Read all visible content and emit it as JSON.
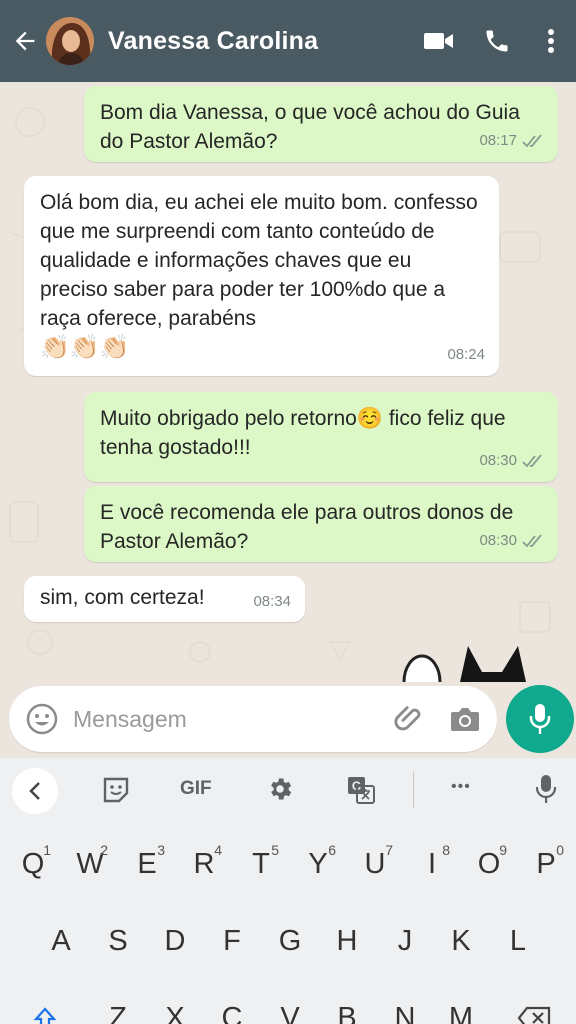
{
  "header": {
    "contact_name": "Vanessa Carolina"
  },
  "messages": [
    {
      "dir": "out",
      "text": "Bom dia Vanessa, o que você achou do Guia do Pastor Alemão?",
      "time": "08:17"
    },
    {
      "dir": "in",
      "text": "Olá bom dia, eu achei ele muito bom. confesso que me surpreendi com tanto conteúdo de qualidade e informações chaves que eu preciso saber para poder ter 100%do que a raça oferece, parabéns",
      "emoji": "👏🏻👏🏻👏🏻",
      "time": "08:24"
    },
    {
      "dir": "out",
      "text_before": "Muito obrigado pelo retorno",
      "emoji": "☺️",
      "text_after": " fico feliz que tenha gostado!!!",
      "time": "08:30"
    },
    {
      "dir": "out",
      "text": "E você recomenda ele para outros donos de Pastor Alemão?",
      "time": "08:30"
    },
    {
      "dir": "in",
      "text": "sim, com certeza!",
      "time": "08:34"
    }
  ],
  "input": {
    "placeholder": "Mensagem"
  },
  "keyboard_toolbar": {
    "gif_label": "GIF",
    "more_label": "•••"
  },
  "keyboard": {
    "row1": [
      {
        "k": "Q",
        "n": "1"
      },
      {
        "k": "W",
        "n": "2"
      },
      {
        "k": "E",
        "n": "3"
      },
      {
        "k": "R",
        "n": "4"
      },
      {
        "k": "T",
        "n": "5"
      },
      {
        "k": "Y",
        "n": "6"
      },
      {
        "k": "U",
        "n": "7"
      },
      {
        "k": "I",
        "n": "8"
      },
      {
        "k": "O",
        "n": "9"
      },
      {
        "k": "P",
        "n": "0"
      }
    ],
    "row2": [
      "A",
      "S",
      "D",
      "F",
      "G",
      "H",
      "J",
      "K",
      "L"
    ],
    "row3": [
      "Z",
      "X",
      "C",
      "V",
      "B",
      "N",
      "M"
    ]
  },
  "colors": {
    "header": "#4a5a63",
    "outgoing_bubble": "#dcf8c6",
    "incoming_bubble": "#ffffff",
    "chat_bg": "#ece5dd",
    "send_button": "#11a98d",
    "read_ticks": "#7d8a83"
  }
}
